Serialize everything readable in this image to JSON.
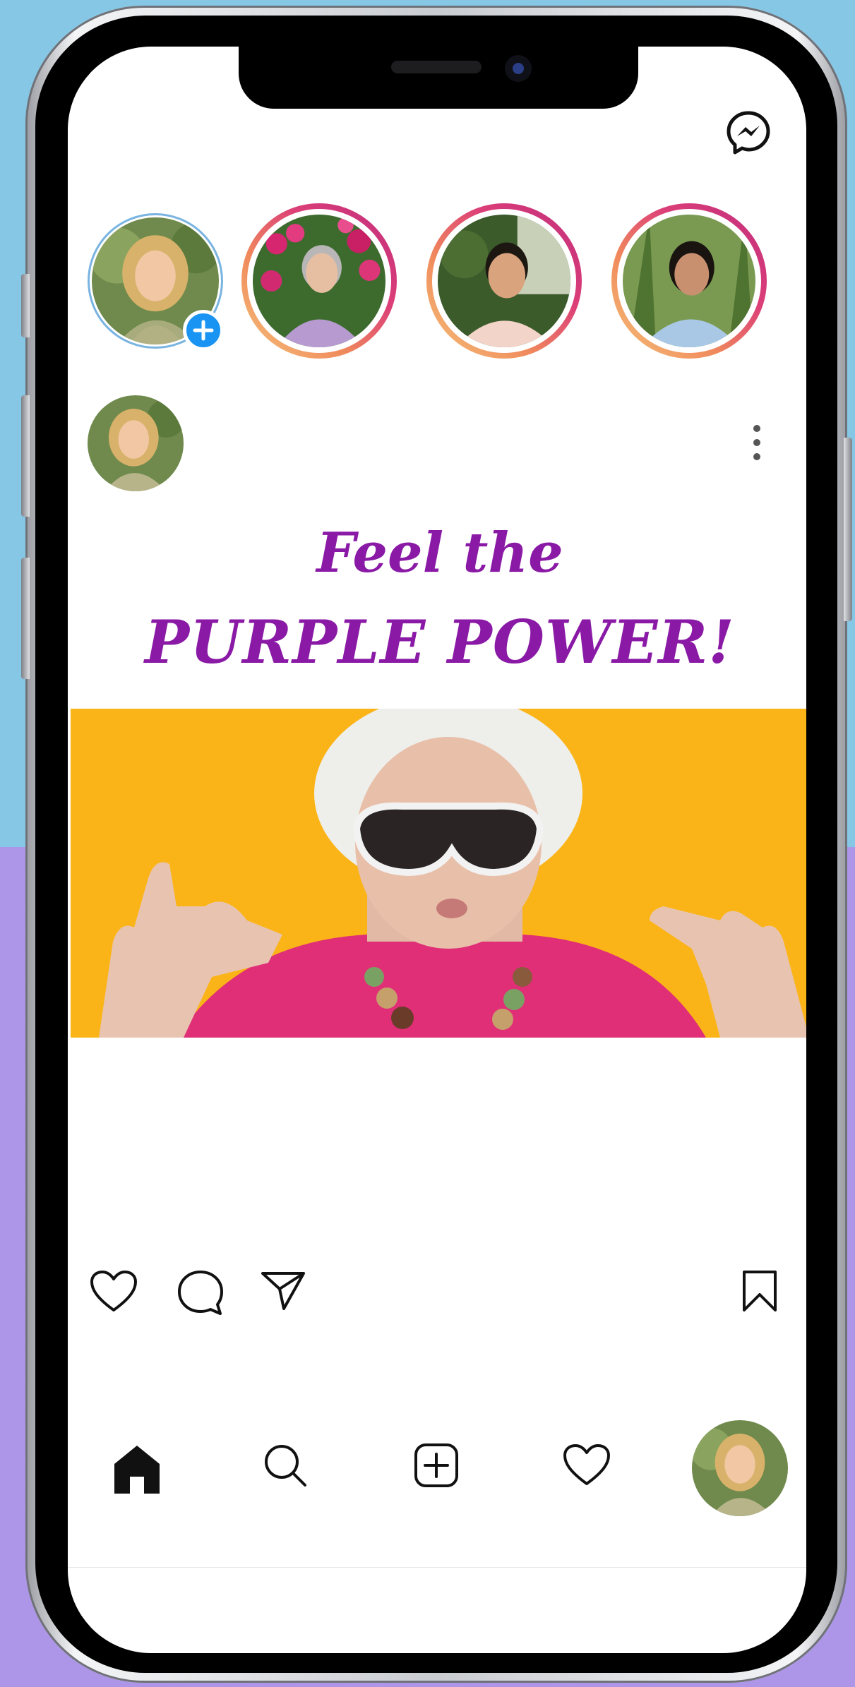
{
  "colors": {
    "background_top": "#87c7e6",
    "background_bottom": "#ad96e8",
    "banner_text": "#8a1aa6",
    "story_ring": [
      "#f5c47a",
      "#f08a5c",
      "#dc3f78",
      "#c02d7e"
    ],
    "add_badge": "#1a94f2",
    "photo_background": "#fbb417"
  },
  "header": {
    "icon": "messenger-icon"
  },
  "stories": [
    {
      "kind": "own",
      "icon": "add-story-plus-icon"
    },
    {
      "kind": "ring"
    },
    {
      "kind": "ring"
    },
    {
      "kind": "ring"
    }
  ],
  "post": {
    "banner_line1": "Feel the",
    "banner_line2": "PURPLE POWER!",
    "more_icon": "more-vertical-icon"
  },
  "actions": {
    "icons": [
      "heart-icon",
      "comment-icon",
      "share-icon",
      "bookmark-icon"
    ]
  },
  "nav": {
    "icons": [
      "home-icon",
      "search-icon",
      "add-post-icon",
      "activity-heart-icon",
      "profile-avatar"
    ]
  }
}
